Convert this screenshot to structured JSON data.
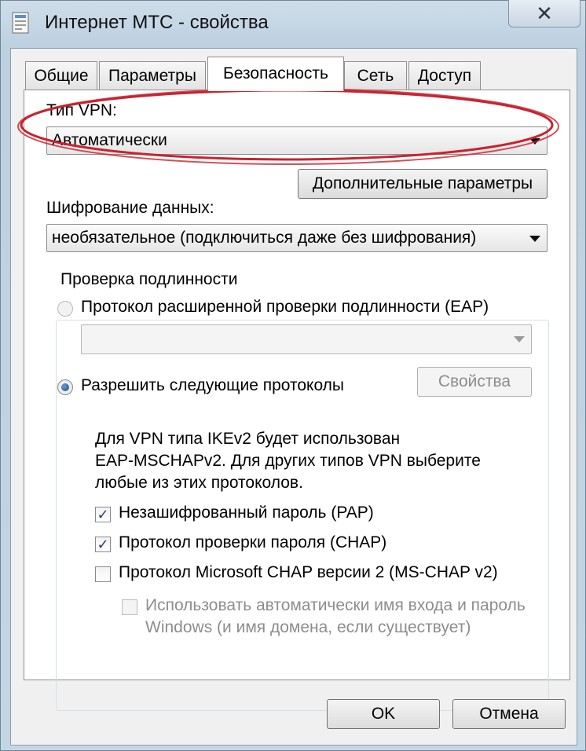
{
  "window": {
    "title": "Интернет МТС - свойства",
    "close_glyph": "✕"
  },
  "tabs": [
    {
      "label": "Общие"
    },
    {
      "label": "Параметры"
    },
    {
      "label": "Безопасность",
      "active": true
    },
    {
      "label": "Сеть"
    },
    {
      "label": "Доступ"
    }
  ],
  "security": {
    "vpn_type_label": "Тип VPN:",
    "vpn_type_value": "Автоматически",
    "advanced_button": "Дополнительные параметры",
    "encryption_label": "Шифрование данных:",
    "encryption_value": "необязательное (подключиться даже без шифрования)",
    "auth_group_title": "Проверка подлинности",
    "eap_radio_label": "Протокол расширенной проверки подлинности (EAP)",
    "eap_radio_checked": false,
    "eap_combo_value": "",
    "allow_radio_label": "Разрешить следующие протоколы",
    "allow_radio_checked": true,
    "properties_button": "Свойства",
    "info_text": [
      "Для VPN типа IKEv2 будет использован",
      "EAP-MSCHAPv2. Для других типов VPN выберите",
      "любые из этих протоколов."
    ],
    "protocols": [
      {
        "label": "Незашифрованный пароль (PAP)",
        "checked": true
      },
      {
        "label": "Протокол проверки пароля (CHAP)",
        "checked": true
      },
      {
        "label": "Протокол Microsoft CHAP версии 2 (MS-CHAP v2)",
        "checked": false
      }
    ],
    "autologon_label": [
      "Использовать автоматически имя входа и пароль",
      "Windows (и имя домена, если существует)"
    ],
    "autologon_checked": false
  },
  "footer": {
    "ok_button": "OK",
    "cancel_button": "Отмена"
  },
  "colors": {
    "highlight_ellipse": "#c8232f",
    "radio_dot": "#1b4f86"
  },
  "icons": {
    "window_icon": "network-connection-icon",
    "close": "close-icon",
    "check": "checkmark-icon"
  }
}
